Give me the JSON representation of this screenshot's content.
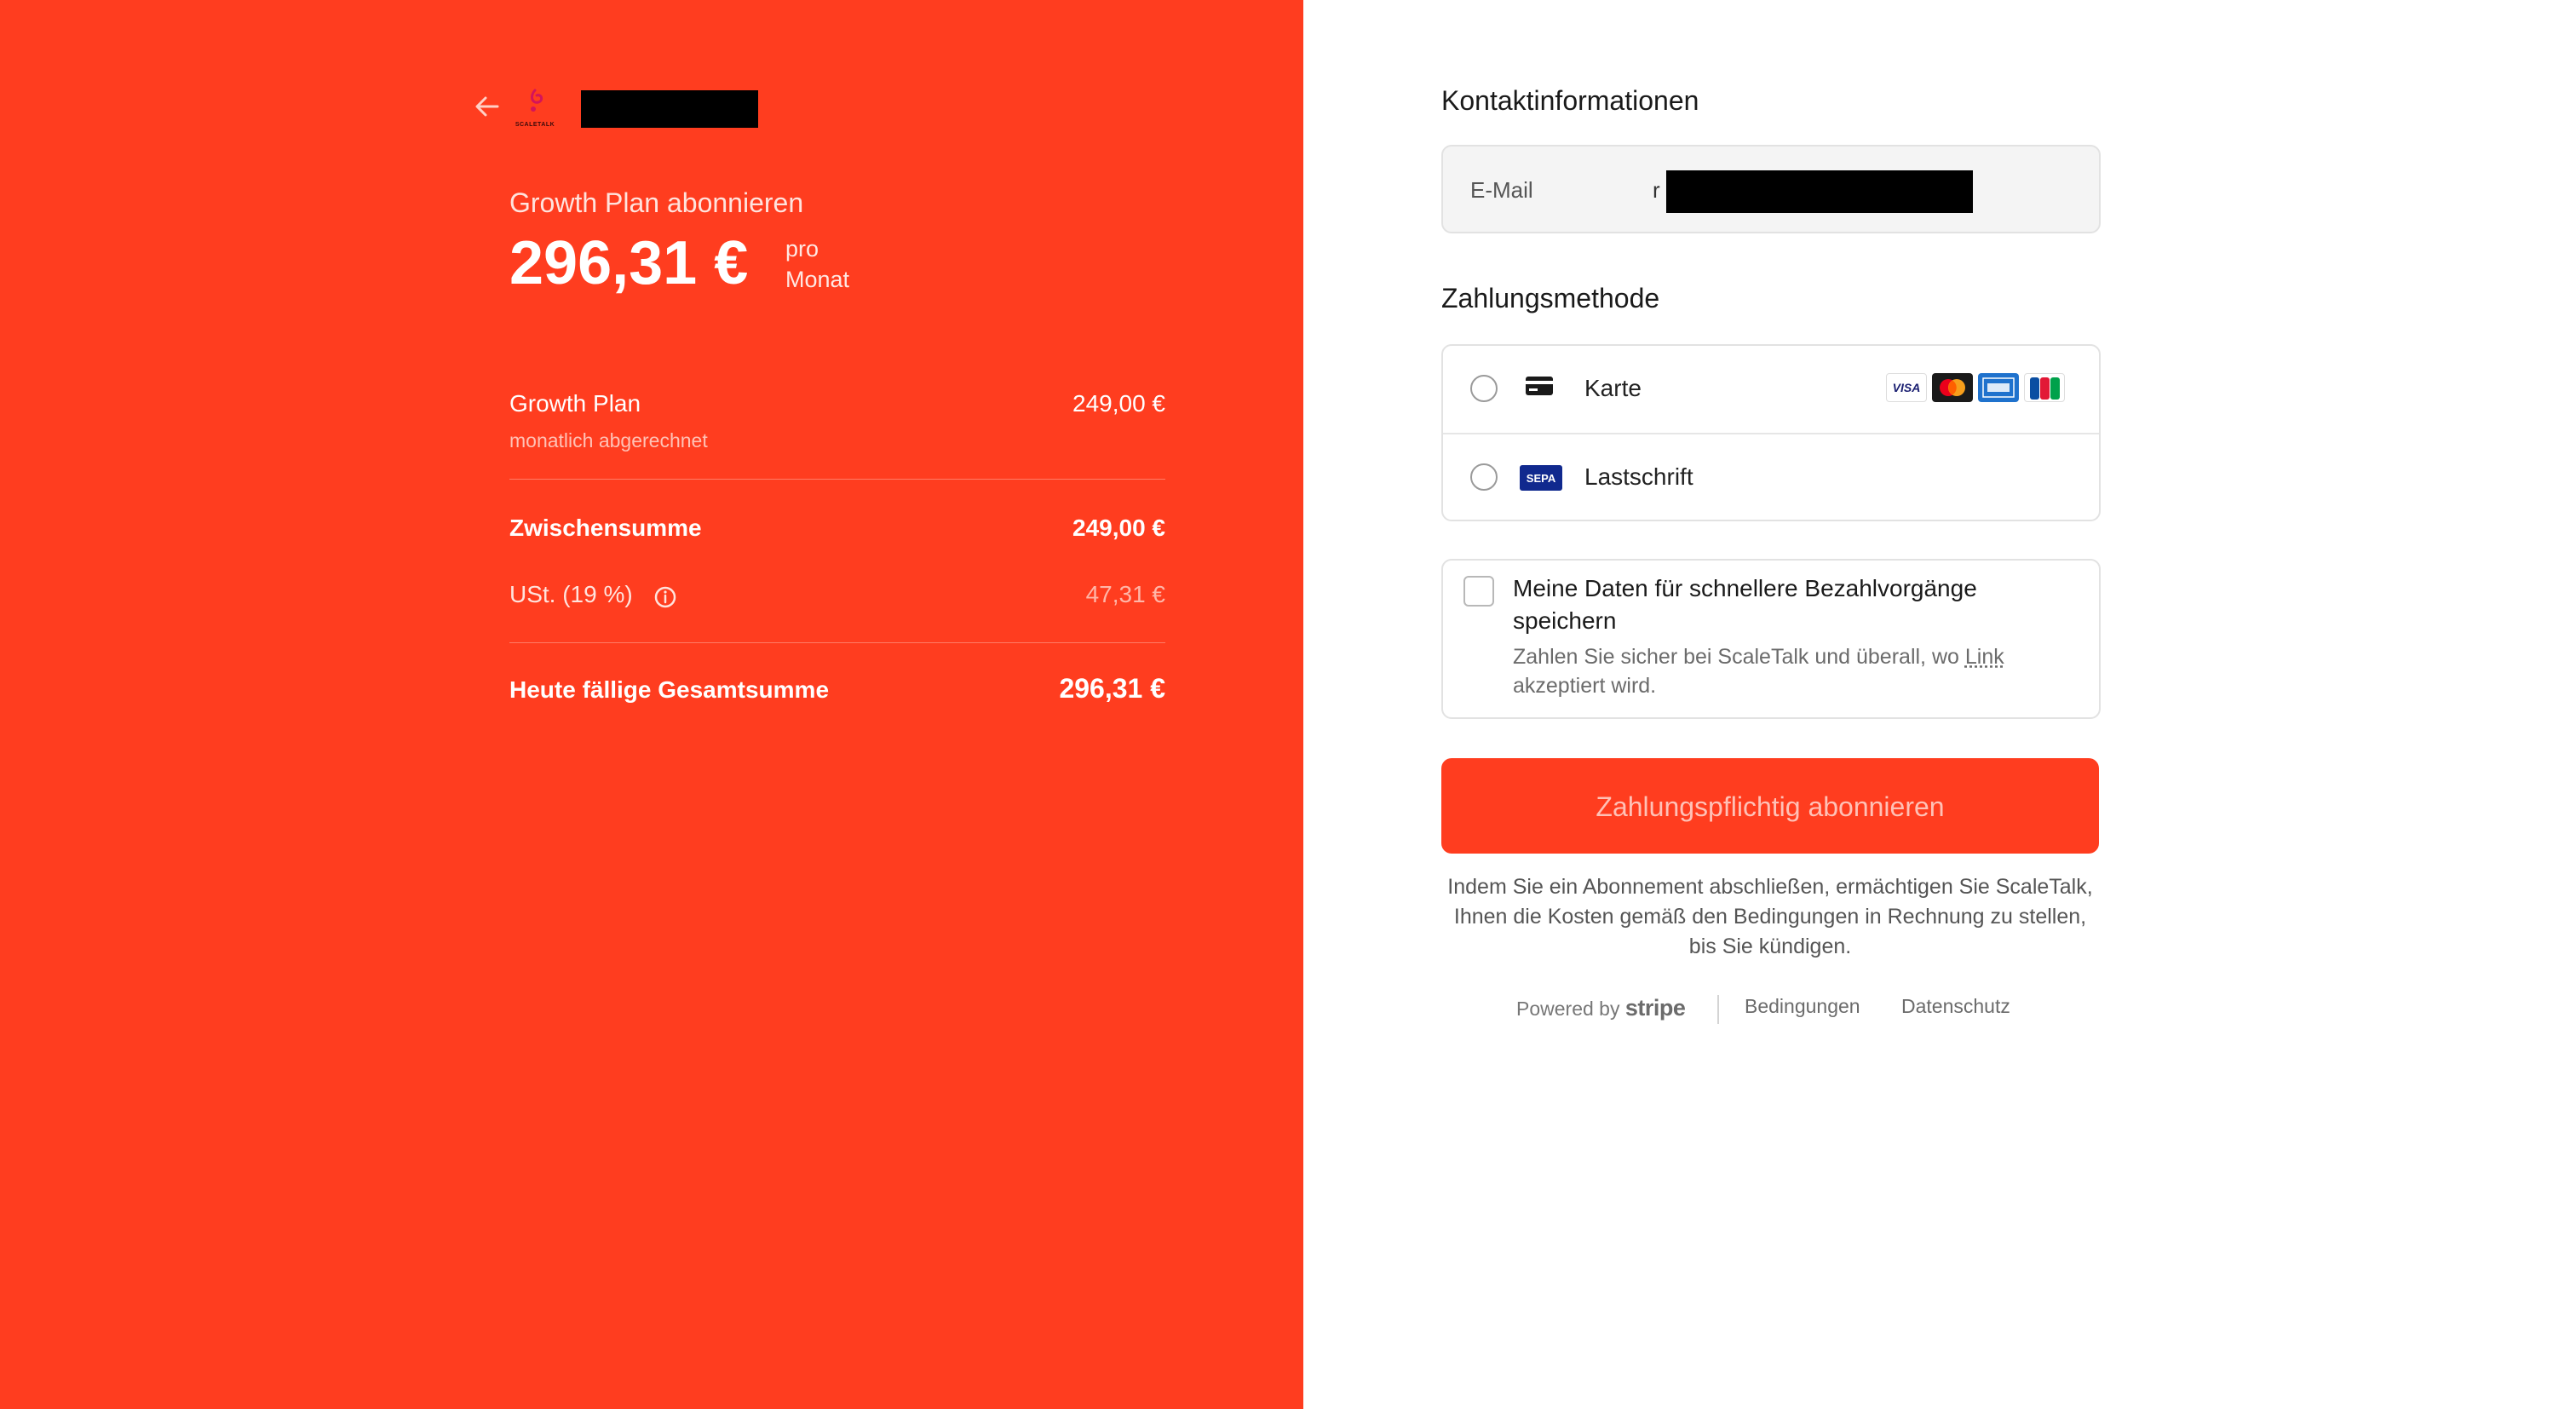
{
  "colors": {
    "accent": "#ff3d1f",
    "panel_bg": "#ffffff"
  },
  "summary": {
    "back_icon": "arrow-left-icon",
    "logo_text": "SCALETALK",
    "subscribe_title": "Growth Plan abonnieren",
    "price": "296,31 €",
    "price_period_line1": "pro",
    "price_period_line2": "Monat",
    "line_item": {
      "name": "Growth Plan",
      "billing": "monatlich abgerechnet",
      "price": "249,00 €"
    },
    "subtotal": {
      "label": "Zwischensumme",
      "value": "249,00 €"
    },
    "tax": {
      "label": "USt. (19 %)",
      "info_icon": "info-icon",
      "value": "47,31 €"
    },
    "total": {
      "label": "Heute fällige Gesamtsumme",
      "value": "296,31 €"
    }
  },
  "contact": {
    "title": "Kontaktinformationen",
    "email_label": "E-Mail",
    "email_value_visible": "r"
  },
  "payment": {
    "title": "Zahlungsmethode",
    "methods": [
      {
        "label": "Karte",
        "icon": "credit-card-icon",
        "brands": [
          "VISA",
          "mastercard",
          "amex",
          "JCB"
        ]
      },
      {
        "label": "Lastschrift",
        "icon": "sepa-icon",
        "icon_text": "SEPA"
      }
    ]
  },
  "save_info": {
    "title": "Meine Daten für schnellere Bezahlvorgänge speichern",
    "desc_prefix": "Zahlen Sie sicher bei ScaleTalk und überall, wo ",
    "desc_link": "Link",
    "desc_suffix": " akzeptiert wird."
  },
  "submit_label": "Zahlungspflichtig abonnieren",
  "legal_text": "Indem Sie ein Abonnement abschließen, ermächtigen Sie ScaleTalk, Ihnen die Kosten gemäß den Bedingungen in Rechnung zu stellen, bis Sie kündigen.",
  "footer": {
    "powered_by": "Powered by",
    "brand": "stripe",
    "terms": "Bedingungen",
    "privacy": "Datenschutz"
  }
}
